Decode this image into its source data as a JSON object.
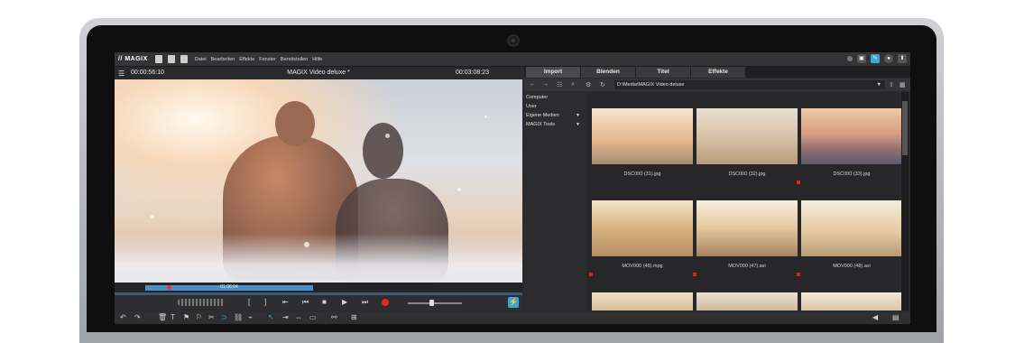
{
  "app": {
    "logo": "// MAGIX",
    "menu": [
      "Datei",
      "Bearbeiten",
      "Effekte",
      "Fenster",
      "Bereitstellen",
      "Hilfe"
    ]
  },
  "player": {
    "menu_glyph": "☰",
    "timecode_left": "00:00:56:10",
    "title": "MAGIX Video deluxe *",
    "timecode_right": "00:03:08:23",
    "scrub_label": "01:06:04"
  },
  "pool": {
    "tabs": [
      "Import",
      "Blenden",
      "Titel",
      "Effekte"
    ],
    "active_tab": "Import",
    "path": "D:\\Media\\MAGIX Video deluxe",
    "tree": [
      {
        "label": "Computer",
        "expandable": false
      },
      {
        "label": "User",
        "expandable": false
      },
      {
        "label": "Eigene Medien",
        "expandable": true
      },
      {
        "label": "MAGIX Tools",
        "expandable": true
      }
    ],
    "files": [
      {
        "name": "DSC000 (31).jpg",
        "marked": false
      },
      {
        "name": "DSC000 (32).jpg",
        "marked": false
      },
      {
        "name": "DSC000 (33).jpg",
        "marked": true
      },
      {
        "name": "MOV000 (46).mpg",
        "marked": true
      },
      {
        "name": "MOV000 (47).avi",
        "marked": true
      },
      {
        "name": "MOV000 (48).avi",
        "marked": true
      }
    ]
  },
  "colors": {
    "accent": "#39a7d8",
    "record": "#e22222",
    "panel": "#2b2b2d"
  }
}
